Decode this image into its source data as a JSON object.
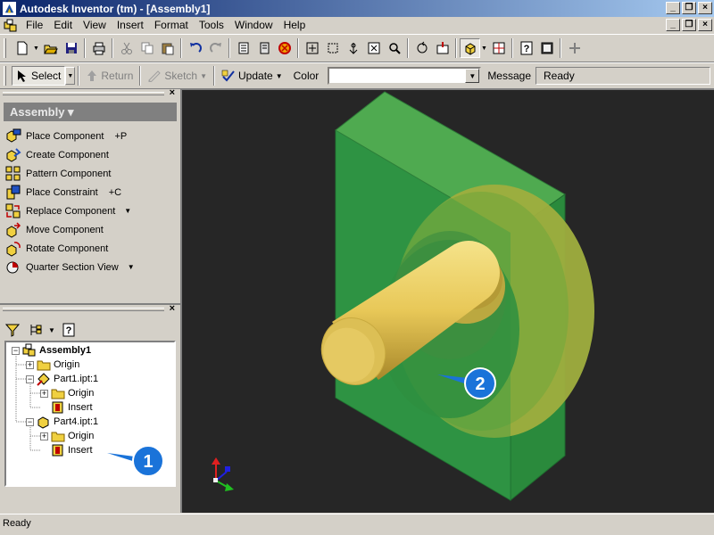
{
  "window": {
    "title": "Autodesk Inventor (tm) - [Assembly1]"
  },
  "menu": [
    "File",
    "Edit",
    "View",
    "Insert",
    "Format",
    "Tools",
    "Window",
    "Help"
  ],
  "command_bar": {
    "select_label": "Select",
    "return_label": "Return",
    "sketch_label": "Sketch",
    "update_label": "Update",
    "color_label": "Color",
    "color_value": "",
    "message_label": "Message",
    "message_value": "Ready"
  },
  "panel_bar": {
    "header": "Assembly ▾",
    "items": [
      {
        "label": "Place Component",
        "shortcut": "+P",
        "icon": "place-component-icon",
        "dropdown": false
      },
      {
        "label": "Create Component",
        "shortcut": "",
        "icon": "create-component-icon",
        "dropdown": false
      },
      {
        "label": "Pattern Component",
        "shortcut": "",
        "icon": "pattern-component-icon",
        "dropdown": false
      },
      {
        "label": "Place Constraint",
        "shortcut": "+C",
        "icon": "place-constraint-icon",
        "dropdown": false
      },
      {
        "label": "Replace Component",
        "shortcut": "",
        "icon": "replace-component-icon",
        "dropdown": true
      },
      {
        "label": "Move Component",
        "shortcut": "",
        "icon": "move-component-icon",
        "dropdown": false
      },
      {
        "label": "Rotate Component",
        "shortcut": "",
        "icon": "rotate-component-icon",
        "dropdown": false
      },
      {
        "label": "Quarter Section View",
        "shortcut": "",
        "icon": "section-view-icon",
        "dropdown": true
      }
    ]
  },
  "browser": {
    "tree": [
      {
        "label": "Assembly1",
        "bold": true,
        "level": 0,
        "expander": "−",
        "icon": "assembly-icon"
      },
      {
        "label": "Origin",
        "level": 1,
        "expander": "+",
        "icon": "folder-icon"
      },
      {
        "label": "Part1.ipt:1",
        "level": 1,
        "expander": "−",
        "icon": "pinned-part-icon"
      },
      {
        "label": "Origin",
        "level": 2,
        "expander": "+",
        "icon": "folder-icon"
      },
      {
        "label": "Insert",
        "level": 2,
        "expander": "",
        "icon": "insert-constraint-icon"
      },
      {
        "label": "Part4.ipt:1",
        "level": 1,
        "expander": "−",
        "icon": "part-icon"
      },
      {
        "label": "Origin",
        "level": 2,
        "expander": "+",
        "icon": "folder-icon"
      },
      {
        "label": "Insert",
        "level": 2,
        "expander": "",
        "icon": "insert-constraint-icon"
      }
    ]
  },
  "callouts": [
    {
      "number": "1"
    },
    {
      "number": "2"
    }
  ],
  "status": {
    "text": "Ready"
  },
  "colors": {
    "title_start": "#0a246a",
    "title_end": "#a6caf0",
    "viewport_bg": "#262626",
    "plate_green": "#2f9a45",
    "shaft_yellow": "#e8cc60",
    "callout_blue": "#1a73d9"
  }
}
